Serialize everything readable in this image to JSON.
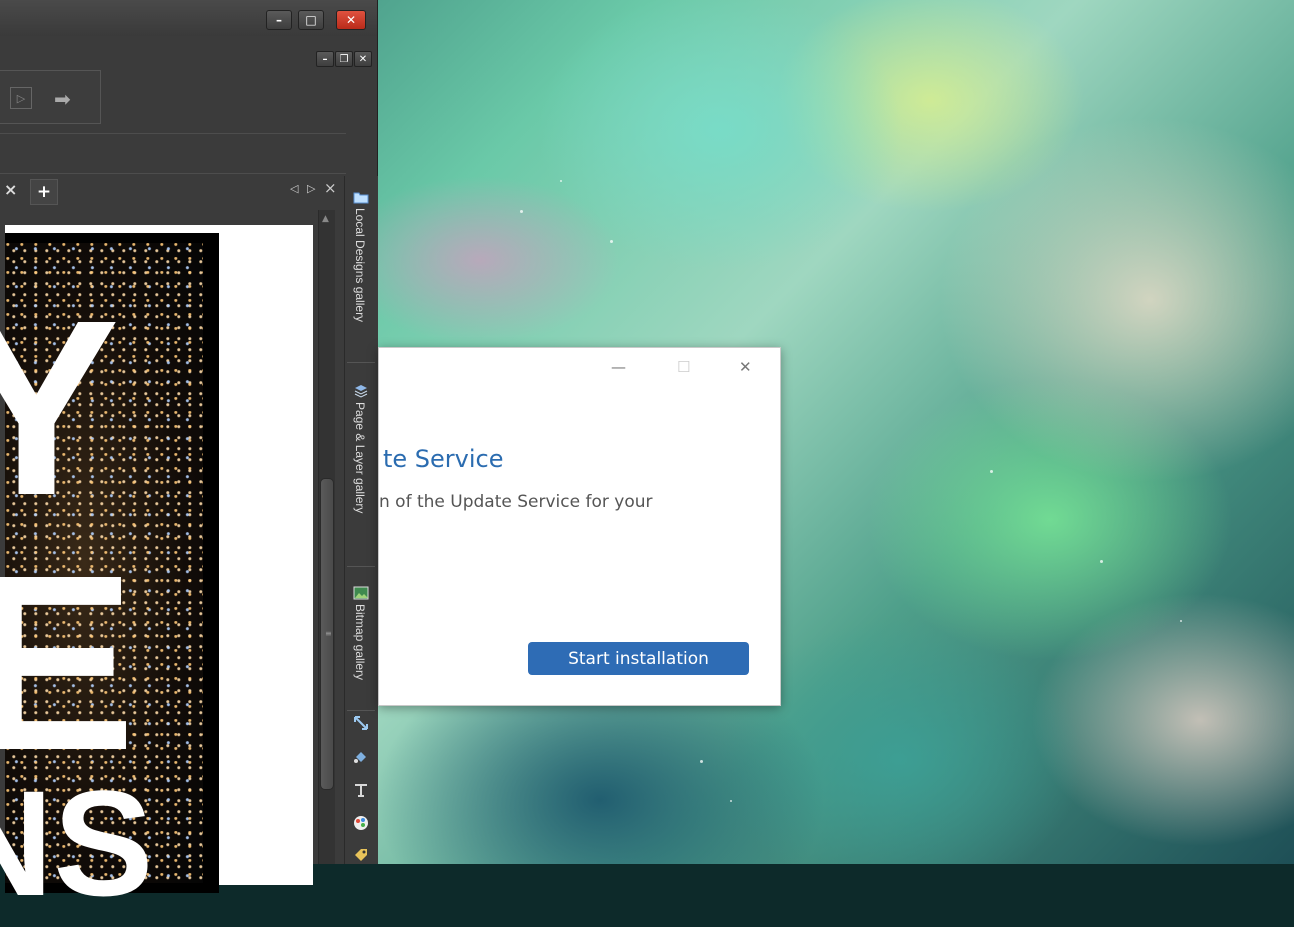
{
  "app": {
    "window_controls": {
      "minimize": "–",
      "maximize": "□",
      "close": "✕"
    },
    "document_controls": {
      "minimize": "–",
      "restore": "❐",
      "close": "✕"
    },
    "tabs": {
      "close_glyph": "×",
      "add_glyph": "+",
      "nav_left": "◁",
      "nav_right": "▷",
      "nav_close": "×"
    },
    "poster_letters": [
      "Y",
      "E",
      "NS"
    ],
    "galleries": [
      {
        "label": "Local Designs gallery",
        "icon": "folder-icon"
      },
      {
        "label": "Page & Layer gallery",
        "icon": "layers-icon"
      },
      {
        "label": "Bitmap gallery",
        "icon": "bitmap-icon"
      }
    ],
    "side_tools": [
      "transform-tool-icon",
      "fill-tool-icon",
      "text-tool-icon",
      "color-palette-icon",
      "tag-icon"
    ]
  },
  "dialog": {
    "controls": {
      "minimize": "—",
      "maximize": "☐",
      "close": "✕"
    },
    "title": "te Service",
    "description": "n of the Update Service for your",
    "start_button": "Start installation"
  },
  "colors": {
    "dialog_accent": "#2e6cb5",
    "title_blue": "#2b6cb0",
    "app_bg": "#3b3b3b",
    "close_red": "#d0402d"
  }
}
